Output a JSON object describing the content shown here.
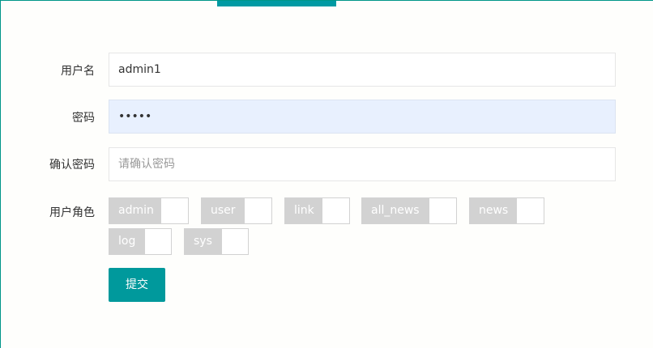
{
  "form": {
    "username": {
      "label": "用户名",
      "value": "admin1"
    },
    "password": {
      "label": "密码",
      "value": "•••••"
    },
    "confirm_password": {
      "label": "确认密码",
      "placeholder": "请确认密码"
    },
    "roles": {
      "label": "用户角色",
      "options": [
        {
          "label": "admin",
          "checked": false
        },
        {
          "label": "user",
          "checked": false
        },
        {
          "label": "link",
          "checked": false
        },
        {
          "label": "all_news",
          "checked": false
        },
        {
          "label": "news",
          "checked": false
        },
        {
          "label": "log",
          "checked": false
        },
        {
          "label": "sys",
          "checked": false
        }
      ]
    },
    "submit_label": "提交"
  },
  "colors": {
    "accent": "#009688",
    "tab_indicator": "#009aa3",
    "button": "#00999c",
    "switch_off": "#d2d2d2",
    "autofill_bg": "#e8f0fe"
  }
}
